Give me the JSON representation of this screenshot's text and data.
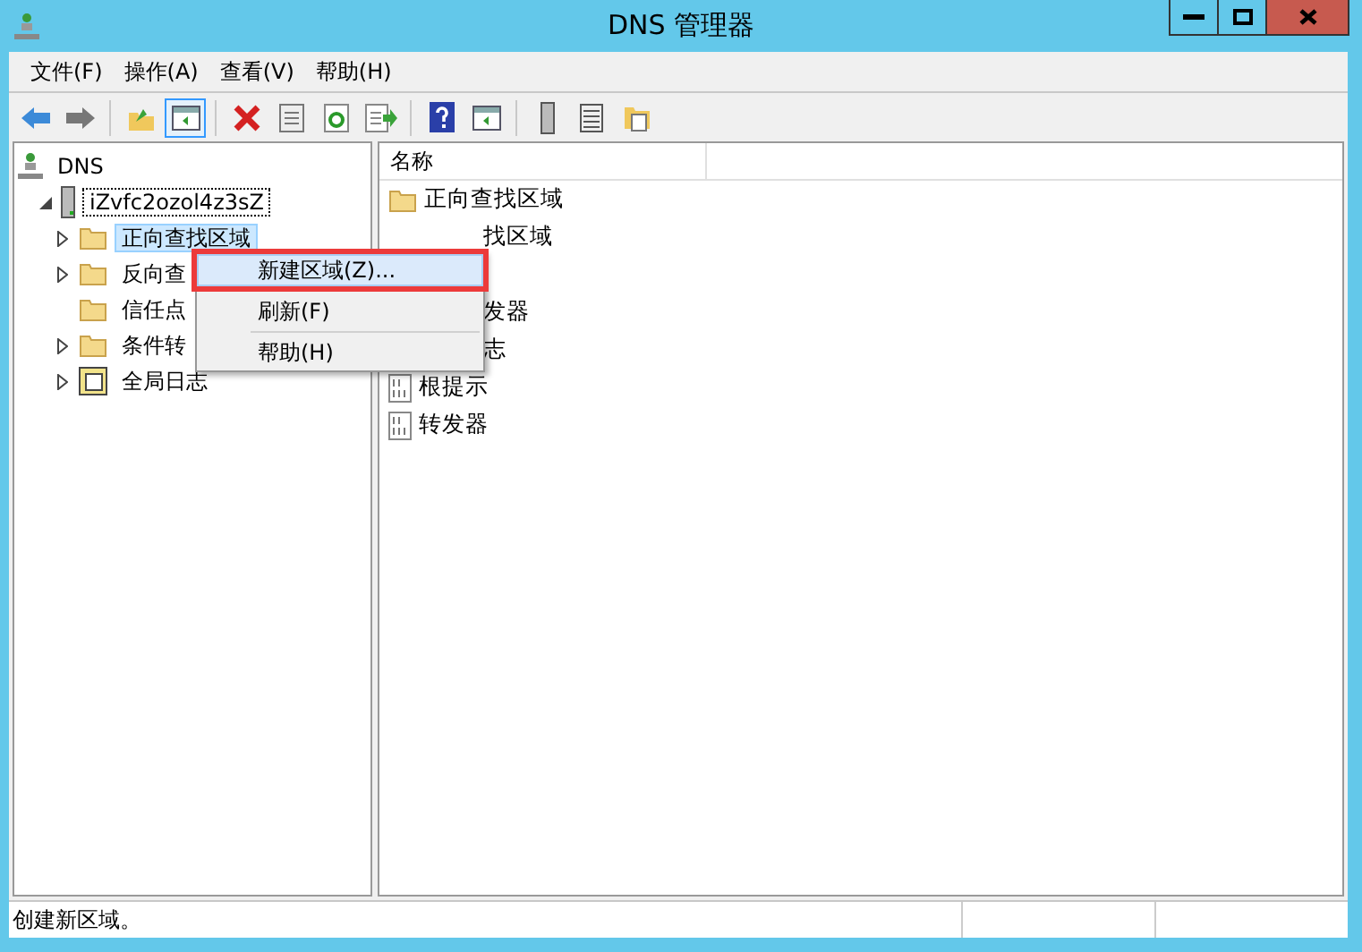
{
  "window": {
    "title": "DNS 管理器"
  },
  "menu_bar": [
    "文件(F)",
    "操作(A)",
    "查看(V)",
    "帮助(H)"
  ],
  "toolbar": [
    {
      "kind": "back",
      "pressed": false
    },
    {
      "kind": "forward",
      "pressed": false
    },
    {
      "kind": "sep"
    },
    {
      "kind": "up",
      "pressed": false
    },
    {
      "kind": "tree",
      "pressed": true
    },
    {
      "kind": "sep"
    },
    {
      "kind": "delete",
      "pressed": false
    },
    {
      "kind": "props",
      "pressed": false
    },
    {
      "kind": "refresh",
      "pressed": false
    },
    {
      "kind": "export",
      "pressed": false
    },
    {
      "kind": "sep"
    },
    {
      "kind": "help",
      "pressed": false
    },
    {
      "kind": "pane",
      "pressed": false
    },
    {
      "kind": "sep"
    },
    {
      "kind": "server",
      "pressed": false
    },
    {
      "kind": "list",
      "pressed": false
    },
    {
      "kind": "folders",
      "pressed": false
    }
  ],
  "tree": {
    "label": "DNS",
    "kind": "dns",
    "children": [
      {
        "label": "iZvfc2ozol4z3sZ",
        "kind": "server",
        "expanded": true,
        "focused": true,
        "children": [
          {
            "label": "正向查找区域",
            "kind": "folder",
            "expandable": true,
            "selected": true
          },
          {
            "label": "反向查",
            "kind": "folder",
            "expandable": true,
            "selected": false
          },
          {
            "label": "信任点",
            "kind": "folder",
            "expandable": false,
            "selected": false
          },
          {
            "label": "条件转",
            "kind": "folder",
            "expandable": true,
            "selected": false
          },
          {
            "label": "全局日志",
            "kind": "log",
            "expandable": true,
            "selected": false
          }
        ]
      }
    ]
  },
  "list": {
    "columns": [
      "名称"
    ],
    "rows": [
      {
        "label": "正向查找区域",
        "kind": "folder"
      },
      {
        "label": "找区域",
        "kind": "clipped"
      },
      {
        "kind": "hidden"
      },
      {
        "label": "发器",
        "kind": "clipped"
      },
      {
        "label": "志",
        "kind": "clipped"
      },
      {
        "label": "根提示",
        "kind": "binary"
      },
      {
        "label": "转发器",
        "kind": "binary"
      }
    ]
  },
  "context_menu": [
    {
      "label": "新建区域(Z)...",
      "selected": true,
      "callout": true
    },
    {
      "label": "刷新(F)",
      "selected": false,
      "callout": false
    },
    {
      "label": "帮助(H)",
      "selected": false,
      "callout": false
    }
  ],
  "status_bar": "创建新区域。"
}
